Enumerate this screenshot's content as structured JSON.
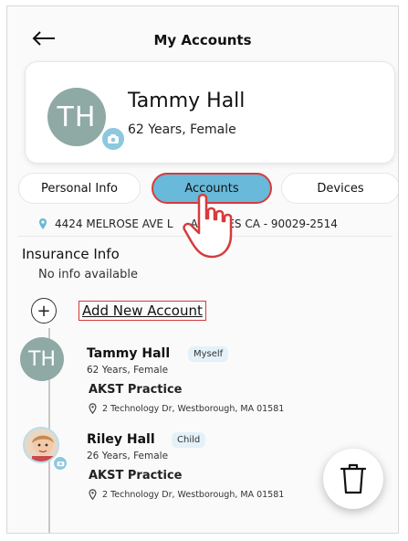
{
  "header": {
    "title": "My Accounts"
  },
  "profile": {
    "initials": "TH",
    "name": "Tammy Hall",
    "meta": "62 Years, Female"
  },
  "tabs": [
    {
      "label": "Personal Info",
      "active": false
    },
    {
      "label": "Accounts",
      "active": true
    },
    {
      "label": "Devices",
      "active": false
    }
  ],
  "address": "4424 MELROSE AVE L     ANGELES CA - 90029-2514",
  "insurance": {
    "title": "Insurance Info",
    "empty_text": "No info available"
  },
  "add_account": {
    "label": "Add New Account"
  },
  "accounts": [
    {
      "initials": "TH",
      "name": "Tammy Hall",
      "relation": "Myself",
      "meta": "62 Years, Female",
      "practice": "AKST Practice",
      "location": "2 Technology Dr, Westborough, MA 01581"
    },
    {
      "name": "Riley Hall",
      "relation": "Child",
      "meta": "26 Years, Female",
      "practice": "AKST Practice",
      "location": "2 Technology Dr, Westborough, MA 01581"
    }
  ],
  "colors": {
    "accent": "#68b9da",
    "highlight": "#d63b3b",
    "avatar": "#8fa9a4"
  },
  "icons": [
    "back-arrow-icon",
    "camera-icon",
    "location-pin-icon",
    "plus-icon",
    "trash-icon",
    "pointer-hand-icon"
  ]
}
